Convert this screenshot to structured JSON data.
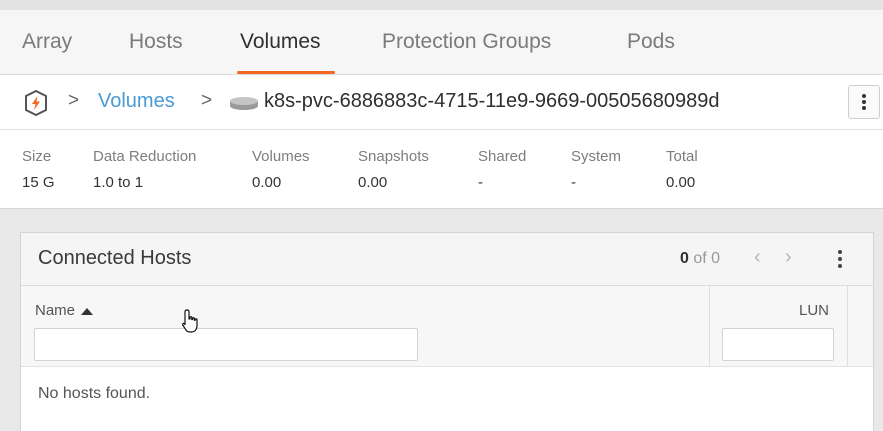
{
  "tabs": [
    {
      "label": "Array",
      "active": false
    },
    {
      "label": "Hosts",
      "active": false
    },
    {
      "label": "Volumes",
      "active": true
    },
    {
      "label": "Protection Groups",
      "active": false
    },
    {
      "label": "Pods",
      "active": false
    }
  ],
  "accent_color": "#f26722",
  "link_color": "#4a9ad6",
  "breadcrumb": {
    "separator": ">",
    "link": "Volumes",
    "volume_name": "k8s-pvc-6886883c-4715-11e9-9669-00505680989d",
    "array_icon": "array-shield-icon",
    "volume_icon": "volume-disk-icon"
  },
  "stats": [
    {
      "label": "Size",
      "value": "15 G"
    },
    {
      "label": "Data Reduction",
      "value": "1.0 to 1"
    },
    {
      "label": "Volumes",
      "value": "0.00"
    },
    {
      "label": "Snapshots",
      "value": "0.00"
    },
    {
      "label": "Shared",
      "value": "-"
    },
    {
      "label": "System",
      "value": "-"
    },
    {
      "label": "Total",
      "value": "0.00"
    }
  ],
  "panel": {
    "title": "Connected Hosts",
    "pager_current": "0",
    "pager_rest": "of 0",
    "prev_glyph": "‹",
    "next_glyph": "›",
    "columns": {
      "name": "Name",
      "lun": "LUN"
    },
    "name_filter_value": "",
    "lun_filter_value": "",
    "empty_text": "No hosts found."
  }
}
